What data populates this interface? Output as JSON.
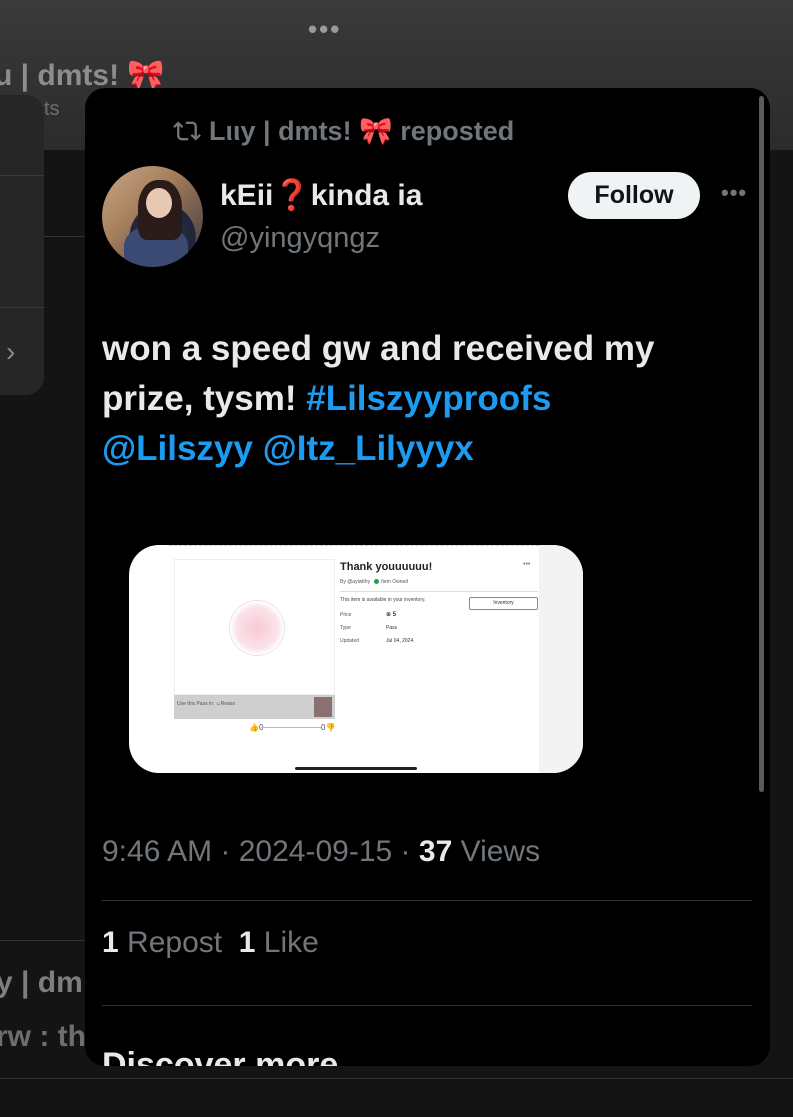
{
  "background": {
    "top_dots": "•••",
    "profile_name": "u | dmts! 🎀",
    "profile_sub": "sts",
    "panel_chevron": "›",
    "lower_name": "y | dm",
    "lower_text": "rw : th"
  },
  "tweet": {
    "repost_label": "Lιιy | dmts! 🎀 reposted",
    "display_name": "kEii❓kinda ia",
    "handle": "@yingyqngz",
    "follow_label": "Follow",
    "more_label": "•••",
    "text_plain": "won a speed gw and received my prize, tysm! ",
    "hashtag": "#Lilszyyproofs",
    "mention_1": "@Lilszyy",
    "mention_2": "@Itz_Lilyyyx",
    "time": "9:46 AM",
    "date": "2024-09-15",
    "views_count": "37",
    "views_label": "Views",
    "repost_count": "1",
    "repost_label_stat": "Repost",
    "like_count": "1",
    "like_label": "Like",
    "discover_label": "Discover more"
  },
  "media": {
    "title": "Thank youuuuuu!",
    "by": "By @aylwithy",
    "owned": "Item Owned",
    "dots": "•••",
    "inventory_text": "This item is available in your inventory.",
    "inventory_button": "Inventory",
    "rows": [
      {
        "label": "Price",
        "value": "⊕ 5"
      },
      {
        "label": "Type",
        "value": "Pass"
      },
      {
        "label": "Updated",
        "value": "Jul 04, 2024"
      }
    ],
    "image_bar_text": "Use this Pass in: ☺Reaso",
    "like_count": "0",
    "dislike_count": "0"
  },
  "colors": {
    "link": "#1d9bf0",
    "muted": "#71767b",
    "text": "#e7e9ea"
  }
}
